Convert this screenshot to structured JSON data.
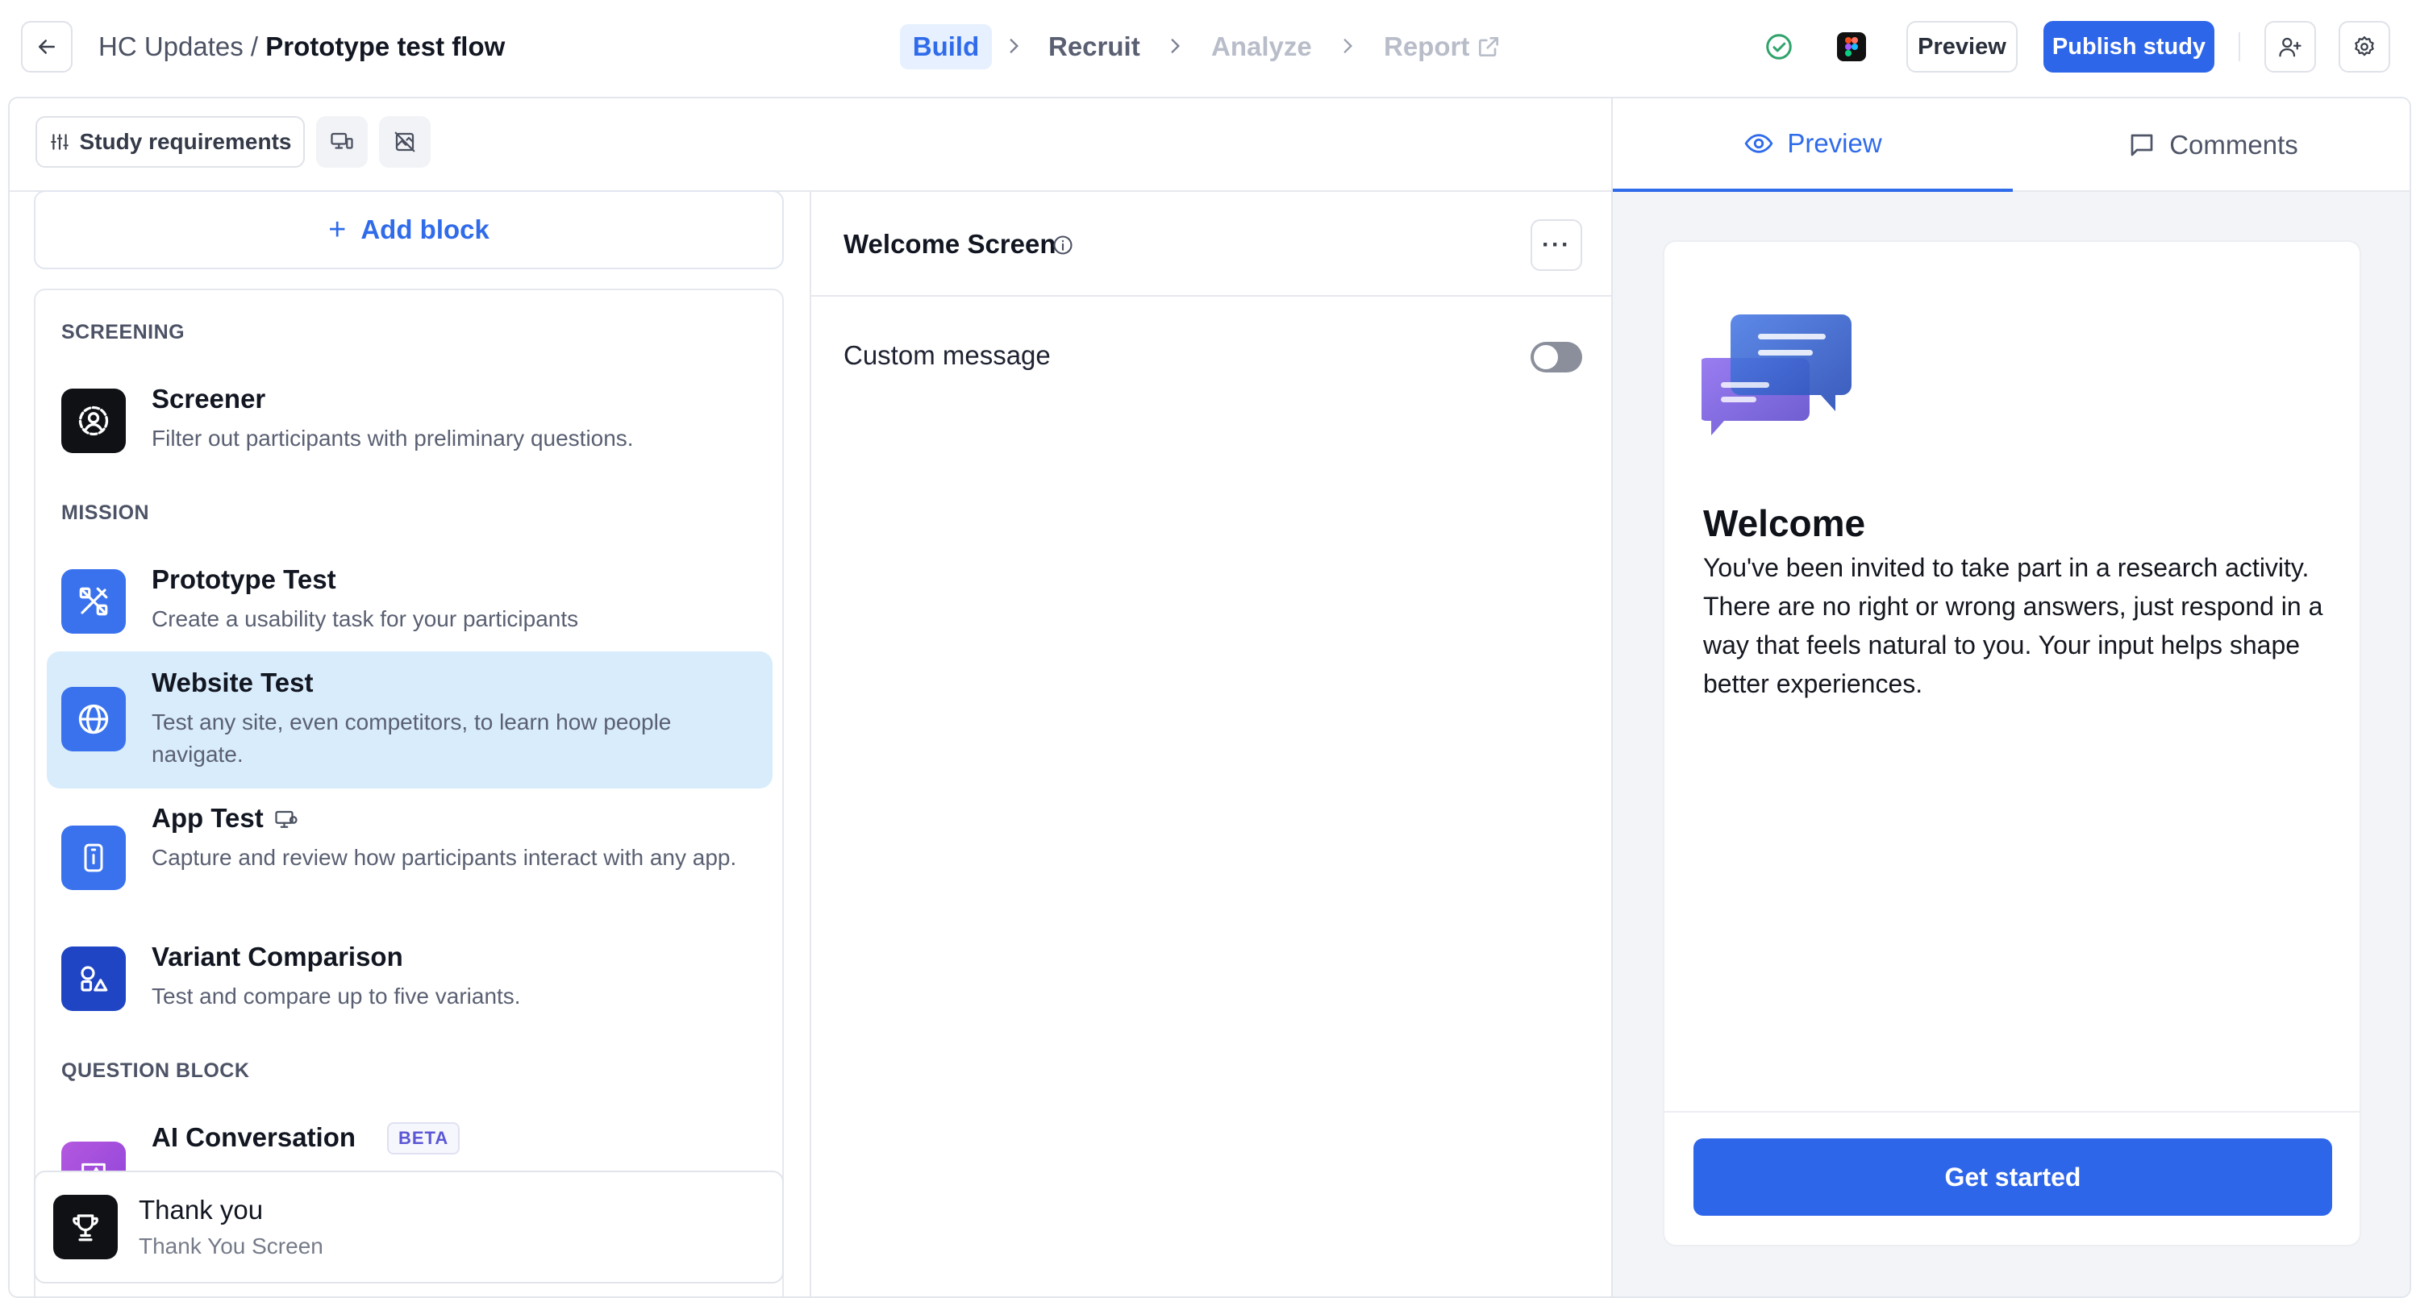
{
  "header": {
    "workspace": "HC Updates",
    "separator": " / ",
    "study_name": "Prototype test flow",
    "steps": [
      "Build",
      "Recruit",
      "Analyze",
      "Report"
    ],
    "preview_label": "Preview",
    "publish_label": "Publish study"
  },
  "toolbar": {
    "study_requirements_label": "Study requirements"
  },
  "library": {
    "add_block_label": "Add block",
    "sections": [
      {
        "heading": "SCREENING",
        "items": [
          {
            "title": "Screener",
            "description": "Filter out participants with preliminary questions."
          }
        ]
      },
      {
        "heading": "MISSION",
        "items": [
          {
            "title": "Prototype Test",
            "description": "Create a usability task for your participants"
          },
          {
            "title": "Website Test",
            "description": "Test any site, even competitors, to learn how people navigate."
          },
          {
            "title": "App Test",
            "description": "Capture and review how participants interact with any app."
          },
          {
            "title": "Variant Comparison",
            "description": "Test and compare up to five variants."
          }
        ]
      },
      {
        "heading": "QUESTION BLOCK",
        "items": [
          {
            "title": "AI Conversation",
            "badge": "BETA"
          }
        ]
      }
    ],
    "selected_item": "Website Test"
  },
  "thank_you": {
    "title": "Thank you",
    "subtitle": "Thank You Screen"
  },
  "editor": {
    "title": "Welcome Screen",
    "more_label": "···",
    "custom_message_label": "Custom message",
    "custom_message_enabled": false
  },
  "preview_panel": {
    "tabs": [
      "Preview",
      "Comments"
    ],
    "active_tab": "Preview",
    "welcome_title": "Welcome",
    "welcome_body": "You've been invited to take part in a research activity. There are no right or wrong answers, just respond in a way that feels natural to you. Your input helps shape better experiences.",
    "cta_label": "Get started"
  },
  "colors": {
    "accent": "#2e66ea",
    "selected_row": "#d8ecfb",
    "active_step_bg": "#e6f0ff",
    "success": "#2fa36b"
  }
}
